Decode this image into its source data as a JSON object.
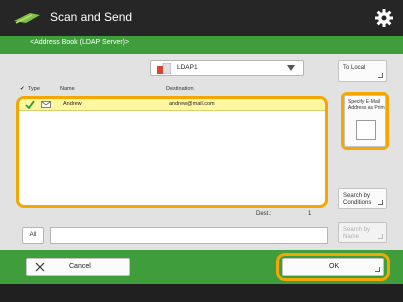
{
  "app": {
    "title": "Scan and Send",
    "icon": "scan-send-icon"
  },
  "subtitle": "<Address Book (LDAP Server)>",
  "server_select": {
    "value": "LDAP1",
    "icon": "server-icon"
  },
  "table": {
    "columns": {
      "type": "Type",
      "name": "Name",
      "destination": "Destination"
    },
    "rows": [
      {
        "checked": true,
        "type_icon": "email-icon",
        "name": "Andrew",
        "destination": "andrew@mail.com",
        "highlight_color": "#fff7a0"
      }
    ]
  },
  "dest_label": "Dest.:",
  "dest_count": "1",
  "all_button": "All",
  "search_input": {
    "value": ""
  },
  "buttons": {
    "to_local": "To Local",
    "specify_email": "Specify E-Mail Address as Prim",
    "search_by_conditions": "Search by Conditions",
    "search_by_name": "Search by Name",
    "cancel": "Cancel",
    "ok": "OK"
  },
  "colors": {
    "accent_green": "#3f9e3b",
    "highlight_orange": "#f4a700",
    "title_bar": "#262626"
  }
}
